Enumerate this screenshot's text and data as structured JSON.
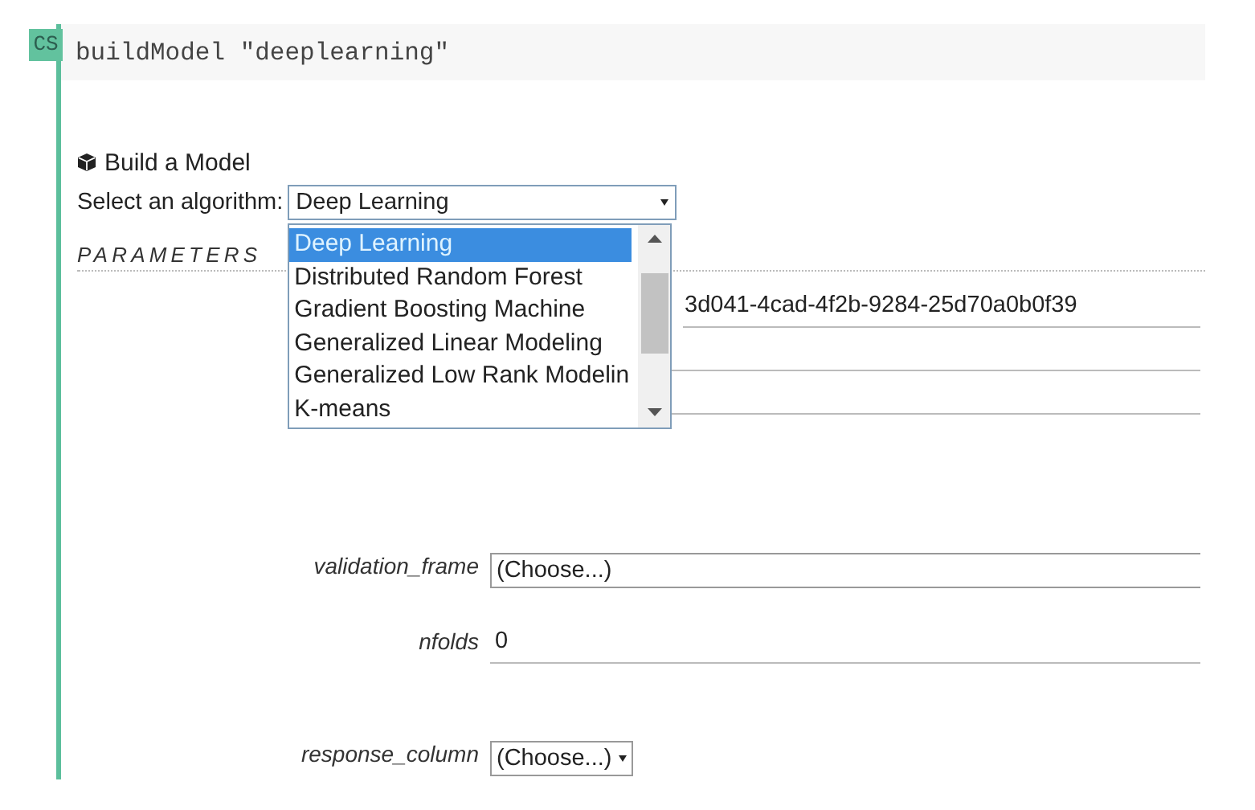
{
  "cell": {
    "badge": "CS",
    "code": "buildModel \"deeplearning\""
  },
  "form": {
    "title": "Build a Model",
    "algorithm_label": "Select an algorithm:",
    "algorithm_value": "Deep Learning",
    "dropdown": {
      "expanded": true,
      "options": [
        {
          "label": "Deep Learning",
          "selected": true
        },
        {
          "label": "Distributed Random Forest",
          "selected": false
        },
        {
          "label": "Gradient Boosting Machine",
          "selected": false
        },
        {
          "label": "Generalized Linear Modeling",
          "selected": false
        },
        {
          "label": "Generalized Low Rank Modelin",
          "selected": false
        },
        {
          "label": "K-means",
          "selected": false
        }
      ]
    },
    "section": "PARAMETERS",
    "parameters": [
      {
        "kind": "text",
        "value": "3d041-4cad-4f2b-9284-25d70a0b0f39"
      },
      {
        "kind": "text"
      },
      {
        "kind": "text"
      },
      {
        "kind": "combo",
        "label": "validation_frame",
        "value": "(Choose...)"
      },
      {
        "kind": "text",
        "label": "nfolds",
        "value": "0"
      },
      {
        "kind": "select",
        "label": "response_column",
        "value": "(Choose...)"
      }
    ]
  }
}
